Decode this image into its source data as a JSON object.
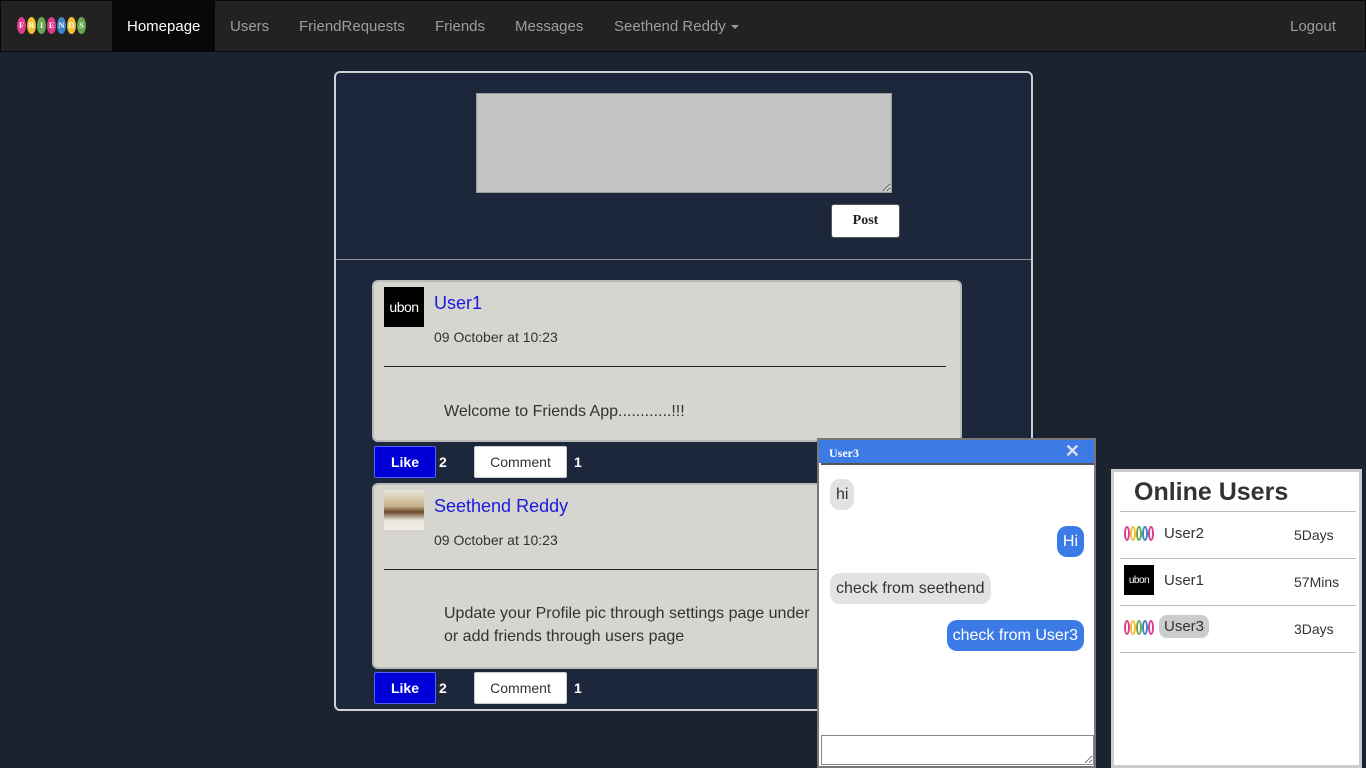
{
  "nav": {
    "brand_letters": [
      "F",
      "R",
      "I",
      "E",
      "N",
      "D",
      "S"
    ],
    "brand_colors": [
      "#e03a8c",
      "#f1c232",
      "#6aa84f",
      "#e03a8c",
      "#3d85c6",
      "#f1c232",
      "#6aa84f"
    ],
    "items": [
      "Homepage",
      "Users",
      "FriendRequests",
      "Friends",
      "Messages",
      "Seethend Reddy"
    ],
    "logout": "Logout"
  },
  "composer": {
    "placeholder": "",
    "post_label": "Post"
  },
  "posts": [
    {
      "author": "User1",
      "avatar_text": "ubon",
      "time": "09 October at 10:23",
      "content": "Welcome to Friends App............!!!",
      "like_label": "Like",
      "likes": "2",
      "comment_label": "Comment",
      "comments": "1"
    },
    {
      "author": "Seethend Reddy",
      "avatar_text": "",
      "time": "09 October at 10:23",
      "content_line1": "Update your Profile pic through settings page under",
      "content_line2": "or add friends through users page",
      "like_label": "Like",
      "likes": "2",
      "comment_label": "Comment",
      "comments": "1"
    }
  ],
  "chat": {
    "title": "User3",
    "close": "✕",
    "messages": [
      {
        "dir": "in",
        "text": "hi"
      },
      {
        "dir": "out",
        "text": "Hi"
      },
      {
        "dir": "in",
        "text": "check from seethend"
      },
      {
        "dir": "out",
        "text": "check from User3"
      }
    ]
  },
  "online": {
    "title": "Online Users",
    "users": [
      {
        "name": "User2",
        "time": "5Days"
      },
      {
        "name": "User1",
        "time": "57Mins"
      },
      {
        "name": "User3",
        "time": "3Days"
      }
    ]
  }
}
